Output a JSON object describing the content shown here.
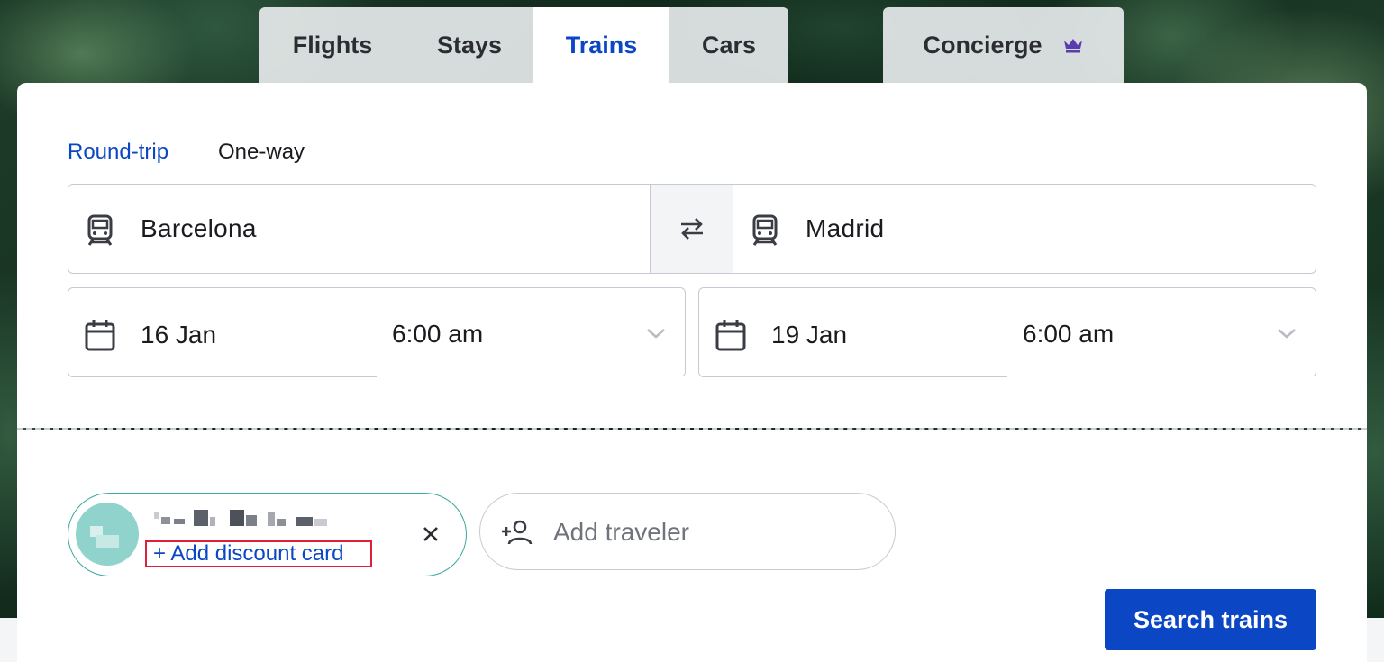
{
  "tabs": {
    "flights": "Flights",
    "stays": "Stays",
    "trains": "Trains",
    "cars": "Cars",
    "concierge": "Concierge",
    "active": "Trains"
  },
  "trip_type": {
    "round_trip": "Round-trip",
    "one_way": "One-way",
    "selected": "Round-trip"
  },
  "route": {
    "from": "Barcelona",
    "to": "Madrid"
  },
  "departure": {
    "date": "16 Jan",
    "time": "6:00 am"
  },
  "return": {
    "date": "19 Jan",
    "time": "6:00 am"
  },
  "traveler": {
    "discount_link": "+ Add discount card",
    "add_traveler": "Add traveler"
  },
  "search_button": "Search trains",
  "colors": {
    "accent": "#0b47c4",
    "highlight": "#e0203a",
    "traveler_border": "#3aa99f",
    "avatar": "#8fd3cc",
    "crown": "#5a3bb0"
  },
  "icons": [
    "train-icon",
    "swap-icon",
    "calendar-icon",
    "chevron-down-icon",
    "close-icon",
    "add-person-icon",
    "crown-icon"
  ]
}
